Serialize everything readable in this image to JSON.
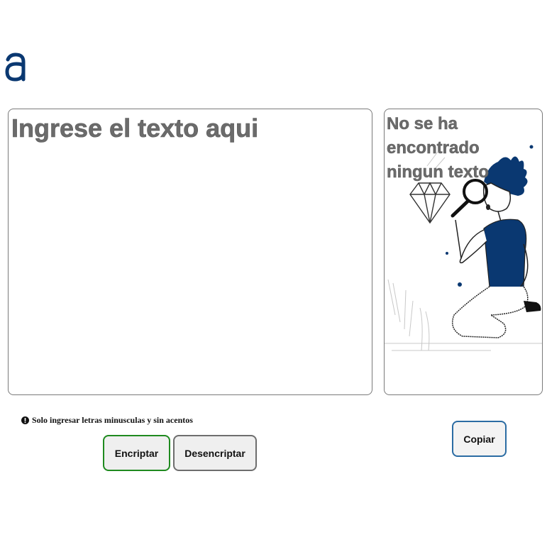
{
  "logo": {
    "glyph": "a",
    "color": "#0a3871"
  },
  "input": {
    "placeholder": "Ingrese el texto aqui",
    "value": ""
  },
  "output": {
    "message": "No se ha encontrado ningun texto"
  },
  "hint": {
    "icon": "exclamation-circle-icon",
    "text": "Solo ingresar letras minusculas y sin acentos"
  },
  "buttons": {
    "encrypt": "Encriptar",
    "decrypt": "Desencriptar",
    "copy": "Copiar"
  },
  "colors": {
    "brand": "#0a3871",
    "encrypt_border": "#1f8a1f",
    "decrypt_border": "#6e6e6e",
    "copy_border": "#2b6ca3",
    "placeholder_text": "#6b6b6b"
  }
}
